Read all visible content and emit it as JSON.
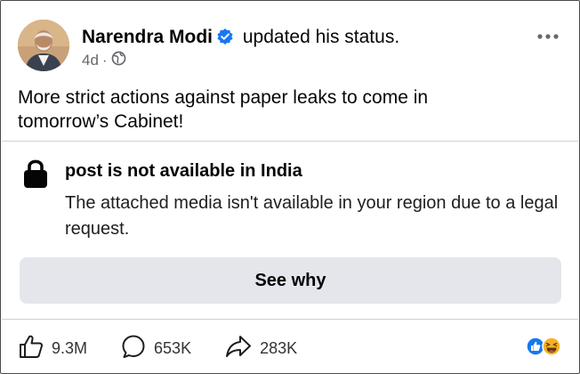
{
  "header": {
    "author_name": "Narendra Modi",
    "action_text": "updated his status.",
    "time_ago": "4d",
    "separator": "·",
    "privacy_icon": "globe-icon",
    "more_icon": "more-options-icon"
  },
  "post": {
    "text_line1": "More strict actions against paper leaks to come in",
    "text_line2": "tomorrow’s Cabinet!"
  },
  "notice": {
    "icon": "lock-icon",
    "title": "post is not available in India",
    "body": "The attached media isn't available in your region due to a legal request.",
    "button_label": "See why"
  },
  "stats": {
    "likes": "9.3M",
    "comments": "653K",
    "shares": "283K"
  },
  "colors": {
    "verified": "#1877f2",
    "button_bg": "#e4e6eb",
    "secondary_text": "#65676b",
    "like_reaction": "#1877f2",
    "haha_reaction": "#f7b125"
  }
}
